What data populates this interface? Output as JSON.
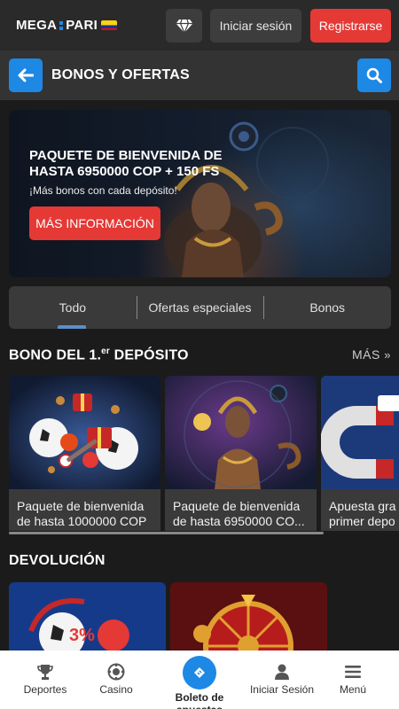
{
  "header": {
    "logo_left": "MEGA",
    "logo_right": "PARI",
    "diamond_icon": "diamond-icon",
    "login_label": "Iniciar sesión",
    "register_label": "Registrarse"
  },
  "subheader": {
    "back_icon": "arrow-left-icon",
    "title": "BONOS Y OFERTAS",
    "search_icon": "search-icon"
  },
  "banner": {
    "title": "PAQUETE DE BIENVENIDA DE HASTA 6950000 COP + 150 FS",
    "subtitle": "¡Más bonos con cada depósito!",
    "button_label": "MÁS INFORMACIÓN"
  },
  "tabs": [
    {
      "label": "Todo",
      "active": true
    },
    {
      "label": "Ofertas especiales",
      "active": false
    },
    {
      "label": "Bonos",
      "active": false
    }
  ],
  "section_first_deposit": {
    "title_prefix": "BONO DEL 1.",
    "title_sup": "er",
    "title_suffix": " DEPÓSITO",
    "more_label": "MÁS",
    "cards": [
      {
        "line1": "Paquete de bienvenida",
        "line2": "de hasta 1000000 COP"
      },
      {
        "line1": "Paquete de bienvenida",
        "line2": "de hasta 6950000 CO..."
      },
      {
        "line1": "Apuesta gra",
        "line2": "primer depo"
      }
    ]
  },
  "section_cashback": {
    "title": "DEVOLUCIÓN",
    "cards": [
      {
        "badge": "3%"
      },
      {
        "badge": ""
      }
    ]
  },
  "bottom_nav": [
    {
      "label": "Deportes",
      "icon": "trophy-icon"
    },
    {
      "label": "Casino",
      "icon": "casino-chip-icon"
    },
    {
      "label": "Boleto de apuestas",
      "icon": "bet-slip-icon"
    },
    {
      "label": "Iniciar Sesión",
      "icon": "user-icon"
    },
    {
      "label": "Menú",
      "icon": "hamburger-menu-icon"
    }
  ],
  "colors": {
    "accent_blue": "#1e88e5",
    "accent_red": "#e53935",
    "background": "#1b1b1b"
  }
}
